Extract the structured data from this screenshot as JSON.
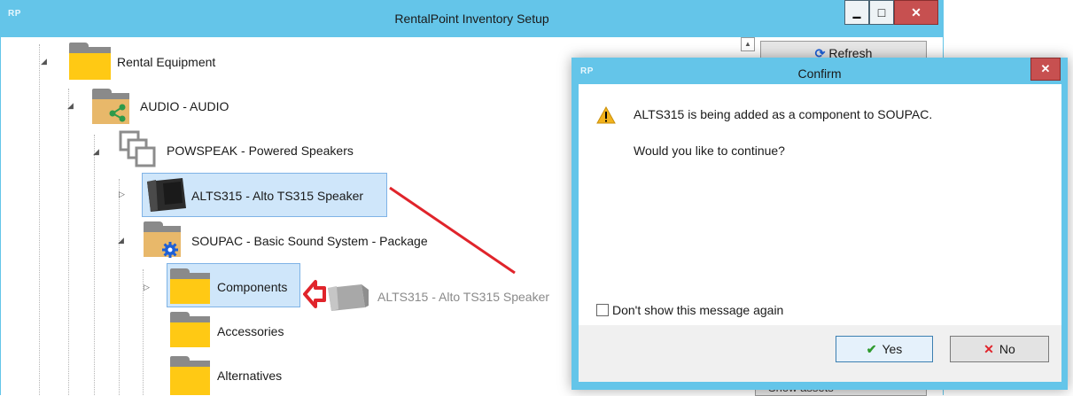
{
  "main_window": {
    "app_badge": "RP",
    "title": "RentalPoint Inventory Setup",
    "minimize": "▁",
    "maximize": "□",
    "close": "✕"
  },
  "right_panel": {
    "refresh_label": "Refresh",
    "show_assets_label": "Show assets"
  },
  "tree": {
    "root": "Rental Equipment",
    "audio": "AUDIO - AUDIO",
    "powspeak": "POWSPEAK - Powered Speakers",
    "alts315": "ALTS315  - Alto TS315 Speaker",
    "soupac": "SOUPAC   - Basic Sound System - Package",
    "components": "Components",
    "accessories": "Accessories",
    "alternatives": "Alternatives",
    "drag_ghost_label": "ALTS315  - Alto TS315 Speaker"
  },
  "dialog": {
    "app_badge": "RP",
    "title": "Confirm",
    "close": "✕",
    "message_line1": "ALTS315 is being added as a component to SOUPAC.",
    "message_line2": "Would you like to continue?",
    "checkbox_label": "Don't show this message again",
    "checkbox_checked": false,
    "yes_label": "Yes",
    "no_label": "No"
  },
  "colors": {
    "titlebar": "#64c5e9",
    "folder_yellow": "#ffc914",
    "folder_tab": "#8a8a8a",
    "selection": "#cfe6fa",
    "arrow_red": "#e0242b",
    "warning": "#f2b21c"
  }
}
